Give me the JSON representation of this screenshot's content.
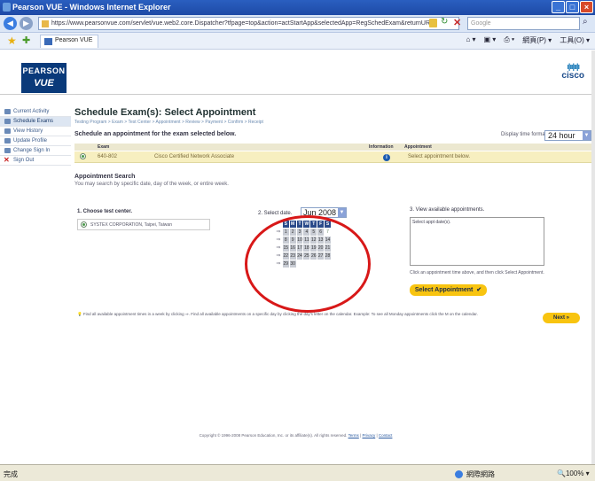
{
  "window": {
    "title": "Pearson VUE - Windows Internet Explorer"
  },
  "browser": {
    "address": "https://www.pearsonvue.com/servlet/vue.web2.core.Dispatcher?tfpage=top&action=actStartApp&selectedApp=RegSchedExam&returnURL=",
    "search_placeholder": "Google",
    "tab_label": "Pearson VUE",
    "tools": [
      "網頁(P) ▾",
      "工具(O) ▾"
    ]
  },
  "header": {
    "logo_line1": "PEARSON",
    "logo_line2": "VUE",
    "partner_logo": "cisco"
  },
  "sidebar": {
    "items": [
      {
        "label": "Current Activity"
      },
      {
        "label": "Schedule Exams"
      },
      {
        "label": "View History"
      },
      {
        "label": "Update Profile"
      },
      {
        "label": "Change Sign In"
      },
      {
        "label": "Sign Out"
      }
    ]
  },
  "main": {
    "title": "Schedule Exam(s): Select Appointment",
    "breadcrumb": "Testing Program > Exam > Test Center > Appointment > Review > Payment > Confirm > Receipt",
    "subheading": "Schedule an appointment for the exam selected below.",
    "display_format_label": "Display time format:",
    "display_format_value": "24 hour"
  },
  "table": {
    "headers": {
      "exam": "Exam",
      "information": "Information",
      "appointment": "Appointment"
    },
    "row": {
      "code": "640-802",
      "name": "Cisco Certified Network Associate",
      "appointment": "Select appointment below."
    }
  },
  "search": {
    "title": "Appointment Search",
    "desc": "You may search by specific date, day of the week, or entire week."
  },
  "step1": {
    "label": "1. Choose test center.",
    "center": "SYSTEX CORPORATION, Taipei, Taiwan"
  },
  "step2": {
    "label": "2. Select date.",
    "month": "Jun 2008"
  },
  "calendar": {
    "days": [
      "S",
      "M",
      "T",
      "W",
      "T",
      "F",
      "S"
    ],
    "weeks": [
      [
        "",
        "1",
        "2",
        "3",
        "4",
        "5",
        "6",
        "7"
      ],
      [
        "",
        "8",
        "9",
        "10",
        "11",
        "12",
        "13",
        "14"
      ],
      [
        "",
        "15",
        "16",
        "17",
        "18",
        "19",
        "20",
        "21"
      ],
      [
        "",
        "22",
        "23",
        "24",
        "25",
        "26",
        "27",
        "28"
      ],
      [
        "",
        "29",
        "30",
        "",
        "",
        "",
        "",
        ""
      ]
    ]
  },
  "step3": {
    "label": "3. View available appointments.",
    "box_text": "Select appt date(s).",
    "hint": "Click an appointment time above, and then click Select Appointment.",
    "button": "Select Appointment"
  },
  "footnote": "Find all available appointment times in a week by clicking ⇒. Find all available appointments on a specific day by clicking the day's letter on the calendar. Example: To see all Monday appointments click the M on the calendar.",
  "next_button": "Next »",
  "copyright": {
    "text": "Copyright © 1996-2008 Pearson Education, Inc. or its affiliate(s). All rights reserved.",
    "terms": "Terms",
    "privacy": "Privacy",
    "contact": "Contact"
  },
  "status": {
    "left": "完成",
    "zone": "網際網路",
    "zoom": "100%"
  }
}
